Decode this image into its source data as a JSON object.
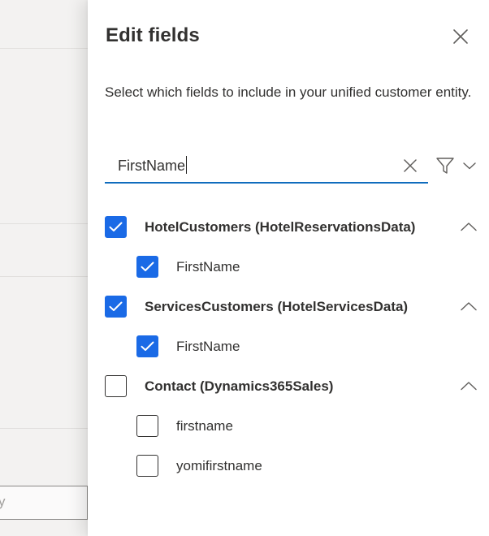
{
  "background": {
    "input_hint": "y"
  },
  "panel": {
    "title": "Edit fields",
    "description": "Select which fields to include in your unified customer entity.",
    "search": {
      "value": "FirstName",
      "placeholder": ""
    },
    "groups": [
      {
        "label": "HotelCustomers (HotelReservationsData)",
        "checked": true,
        "expanded": true,
        "fields": [
          {
            "label": "FirstName",
            "checked": true
          }
        ]
      },
      {
        "label": "ServicesCustomers (HotelServicesData)",
        "checked": true,
        "expanded": true,
        "fields": [
          {
            "label": "FirstName",
            "checked": true
          }
        ]
      },
      {
        "label": "Contact (Dynamics365Sales)",
        "checked": false,
        "expanded": true,
        "fields": [
          {
            "label": "firstname",
            "checked": false
          },
          {
            "label": "yomifirstname",
            "checked": false
          }
        ]
      }
    ]
  },
  "icons": {
    "close": "close-icon",
    "clear": "close-icon",
    "filter": "filter-icon",
    "filter_dropdown": "chevron-down-icon",
    "collapse": "chevron-up-icon",
    "check": "checkmark-icon"
  },
  "colors": {
    "accent": "#1a6ae6",
    "search_underline": "#0f6cbd",
    "text": "#323130",
    "backdrop": "#f3f2f1"
  }
}
